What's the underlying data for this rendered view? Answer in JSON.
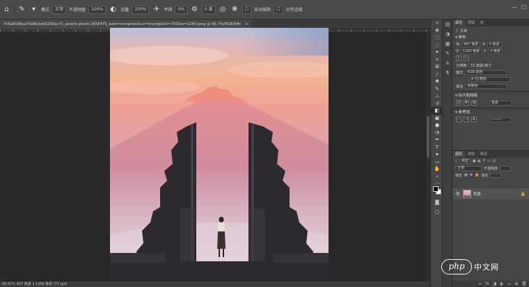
{
  "options_bar": {
    "mode_label": "模式",
    "mode_value": "正常",
    "opacity_label": "不透明度",
    "opacity_value": "100%",
    "flow_label": "流量",
    "flow_value": "100%",
    "smoothing_label": "平滑",
    "smoothing_value": "0%",
    "angle_value": "0 度",
    "brush_size": "1",
    "stroke_width": "1 像素",
    "auto_label": "自动抹除",
    "align_label": "对齐边缘"
  },
  "document_tab": {
    "title": "7c6a6598aa70d8e2eb5258ec71_pexels-photo-2658475_auto=compress&cs=tinysrgb&h=750&w=1260.jpeg @ 66.7%(RGB/8#)",
    "close": "×"
  },
  "status_bar": {
    "text": "66.67%   967 像素 x 1260 像素 (72 ppi)"
  },
  "properties": {
    "tabs": [
      "属性",
      "调整",
      "库"
    ],
    "active_tab": "属性",
    "doc_label": "文档",
    "canvas_section": "画布",
    "w_label": "W",
    "w_value": "967 像素",
    "x_label": "X",
    "x_value": "0 像素",
    "h_label": "H",
    "h_value": "1260 像素",
    "y_label": "Y",
    "y_value": "0 像素",
    "resolution": "分辨率：72 像素/英寸",
    "mode_label": "模式",
    "mode_value": "RGB 颜色",
    "depth_value": "8 位/通道",
    "fill_label": "填充",
    "fill_value": "背景色",
    "guides_section": "标尺和网格",
    "guides_unit": "像素",
    "ref_section": "参考线"
  },
  "layers": {
    "tabs": [
      "图层",
      "通道",
      "路径"
    ],
    "active_tab": "图层",
    "kind_label": "类型",
    "blend_value": "正常",
    "opacity_label": "不透明度",
    "lock_label": "锁定",
    "fill_label": "填充",
    "layer_name": "背景"
  },
  "watermark": {
    "logo": "php",
    "text": "中文网"
  },
  "colors": {
    "foreground": "#000000",
    "background": "#ffffff"
  }
}
